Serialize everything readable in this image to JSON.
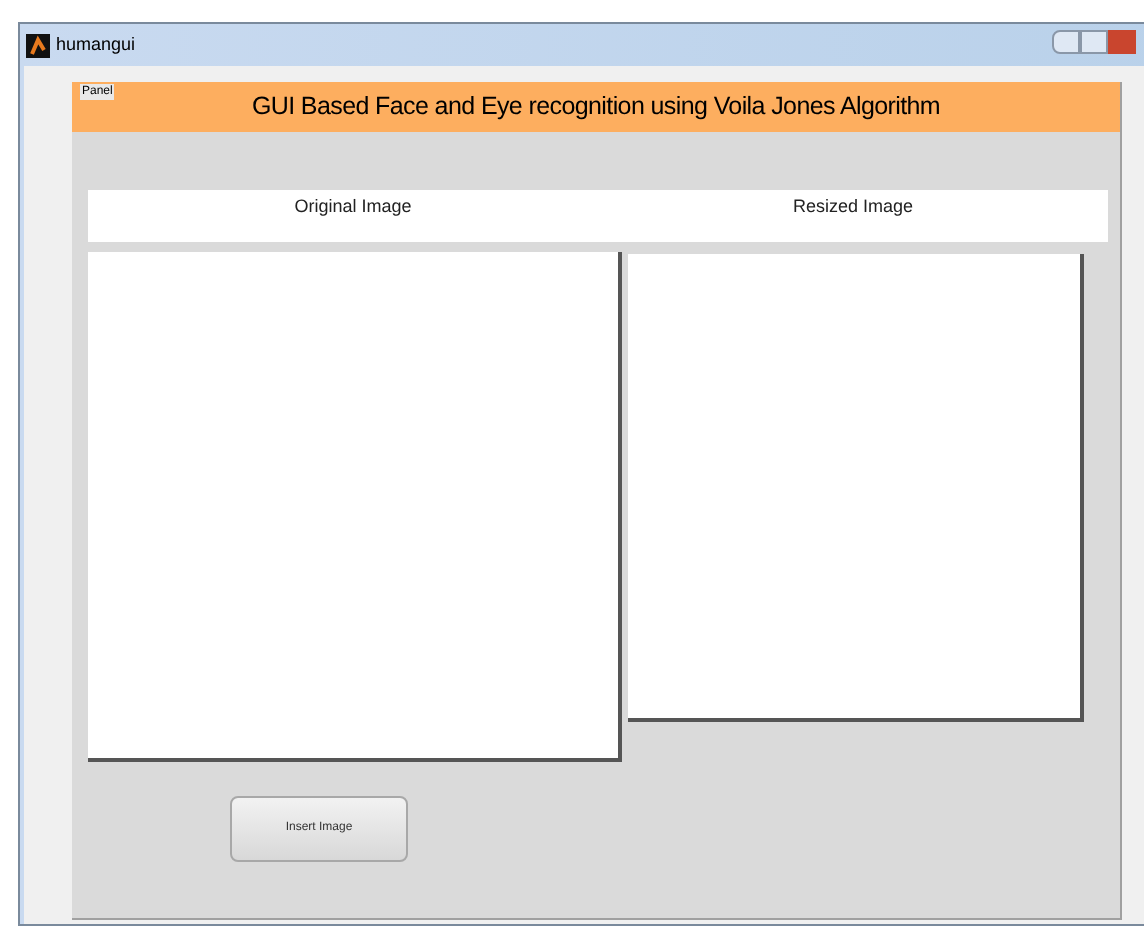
{
  "window": {
    "title": "humangui"
  },
  "panel": {
    "label": "Panel",
    "heading": "GUI Based Face and Eye recognition using Voila Jones Algorithm"
  },
  "image_labels": [
    "Original Image",
    "Resized Image"
  ],
  "buttons": [
    "Insert Image"
  ]
}
